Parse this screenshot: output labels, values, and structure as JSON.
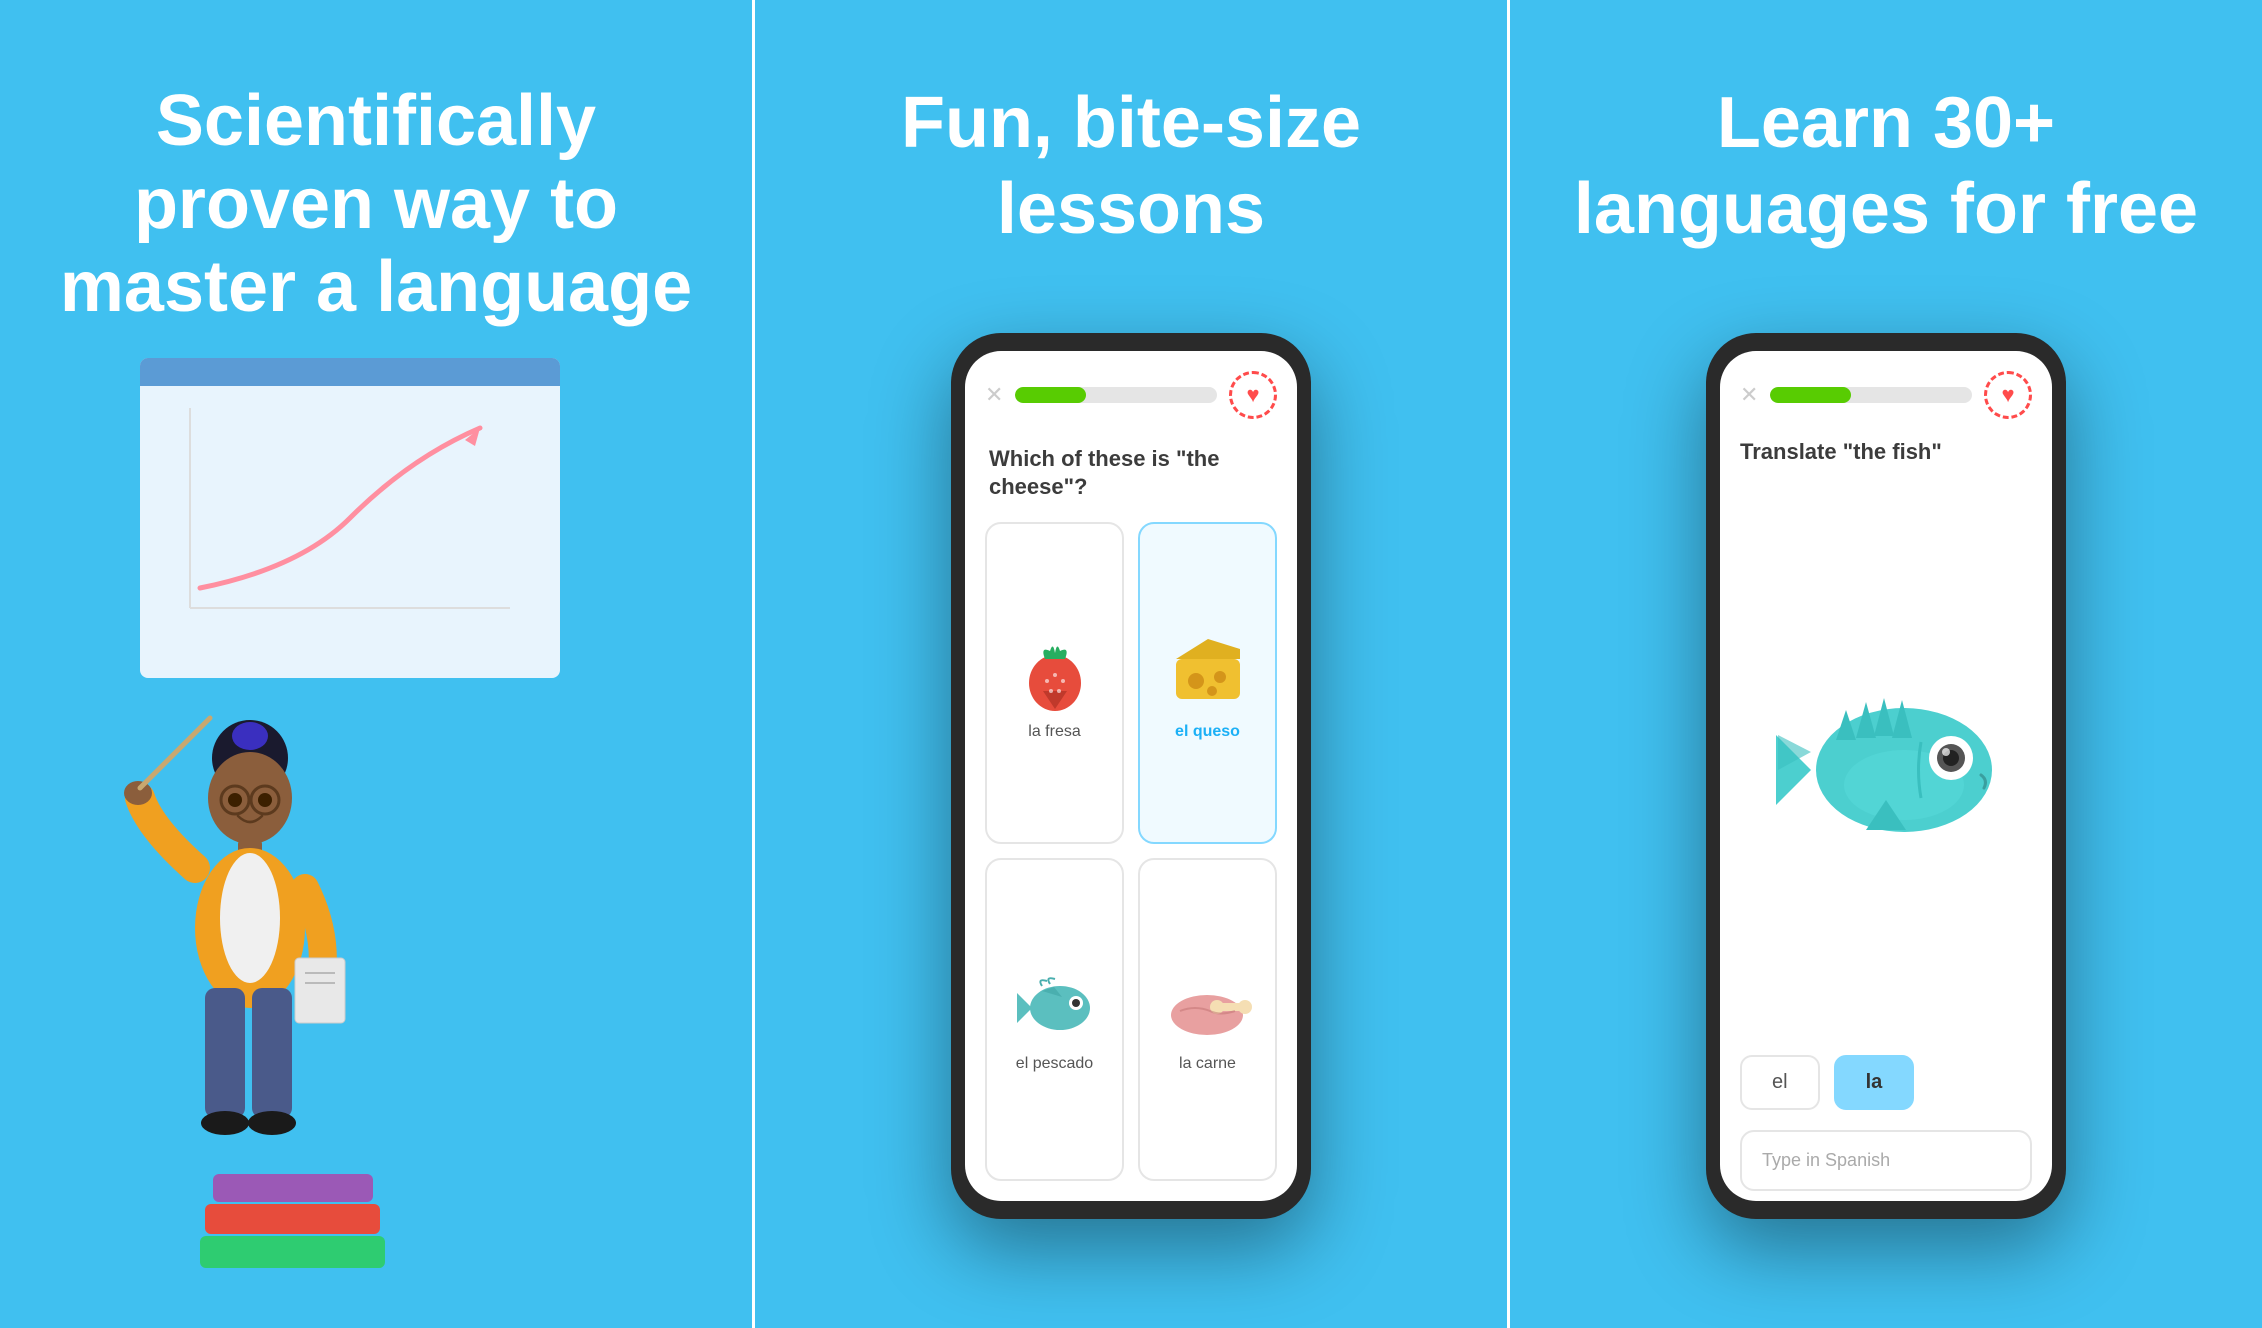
{
  "panel1": {
    "title": "Scientifically proven way to master a language",
    "bg_color": "#40C0F0"
  },
  "panel2": {
    "title": "Fun, bite-size lessons",
    "bg_color": "#40C0F0",
    "phone": {
      "progress": 35,
      "question": "Which of these is \"the cheese\"?",
      "options": [
        {
          "label": "la fresa",
          "icon": "strawberry",
          "selected": false
        },
        {
          "label": "el queso",
          "icon": "cheese",
          "selected": true
        },
        {
          "label": "el pescado",
          "icon": "fish",
          "selected": false
        },
        {
          "label": "la carne",
          "icon": "meat",
          "selected": false
        }
      ]
    }
  },
  "panel3": {
    "title": "Learn 30+ languages for free",
    "bg_color": "#40C0F0",
    "phone": {
      "progress": 40,
      "question": "Translate \"the fish\"",
      "chips": [
        {
          "label": "el",
          "selected": false
        },
        {
          "label": "la",
          "selected": true
        }
      ],
      "input_placeholder": "Type in Spanish"
    }
  }
}
